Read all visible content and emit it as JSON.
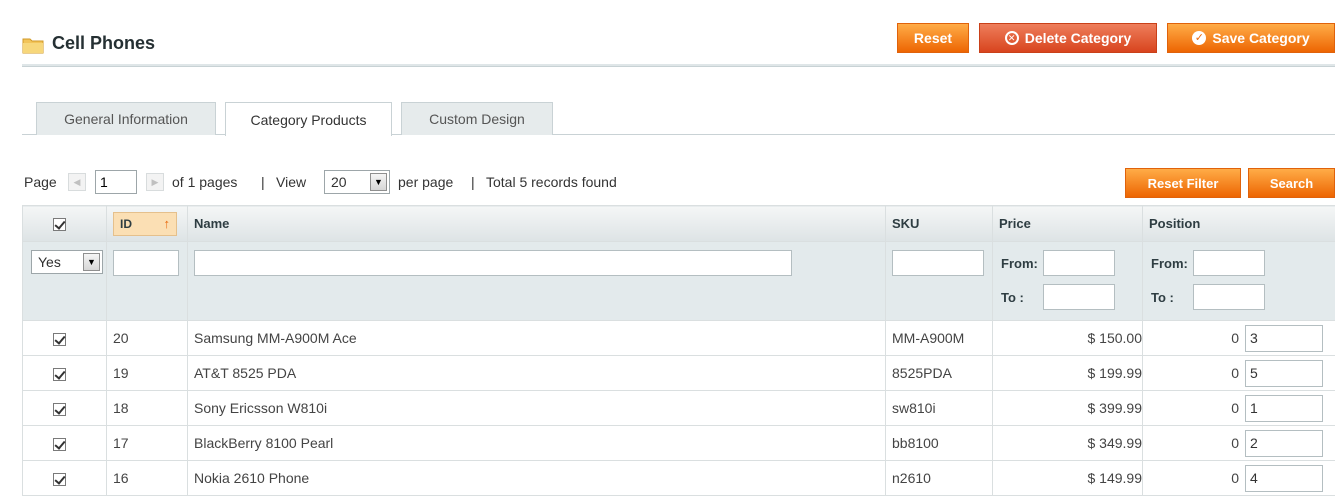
{
  "header": {
    "title": "Cell Phones",
    "buttons": {
      "reset": "Reset",
      "delete": "Delete Category",
      "save": "Save Category"
    }
  },
  "tabs": [
    "General Information",
    "Category Products",
    "Custom Design"
  ],
  "active_tab": "Category Products",
  "pager": {
    "page_label": "Page",
    "page_value": "1",
    "of_pages": "of 1 pages",
    "view_label": "View",
    "per_page_value": "20",
    "per_page_label": "per page",
    "total": "Total 5 records found",
    "sep": "|",
    "reset_filter": "Reset Filter",
    "search": "Search"
  },
  "columns": {
    "id": "ID",
    "name": "Name",
    "sku": "SKU",
    "price": "Price",
    "position": "Position"
  },
  "filters": {
    "in_category": "Yes",
    "from": "From:",
    "to": "To :"
  },
  "rows": [
    {
      "id": "20",
      "name": "Samsung MM-A900M Ace",
      "sku": "MM-A900M",
      "price": "$ 150.00",
      "pos_default": "0",
      "position": "3"
    },
    {
      "id": "19",
      "name": "AT&T 8525 PDA",
      "sku": "8525PDA",
      "price": "$ 199.99",
      "pos_default": "0",
      "position": "5"
    },
    {
      "id": "18",
      "name": "Sony Ericsson W810i",
      "sku": "sw810i",
      "price": "$ 399.99",
      "pos_default": "0",
      "position": "1"
    },
    {
      "id": "17",
      "name": "BlackBerry 8100 Pearl",
      "sku": "bb8100",
      "price": "$ 349.99",
      "pos_default": "0",
      "position": "2"
    },
    {
      "id": "16",
      "name": "Nokia 2610 Phone",
      "sku": "n2610",
      "price": "$ 149.99",
      "pos_default": "0",
      "position": "4"
    }
  ],
  "colors": {
    "orange": "#ed6502",
    "red": "#d8441e",
    "header_bg": "#dde3e5",
    "filter_bg": "#e3eaec"
  }
}
